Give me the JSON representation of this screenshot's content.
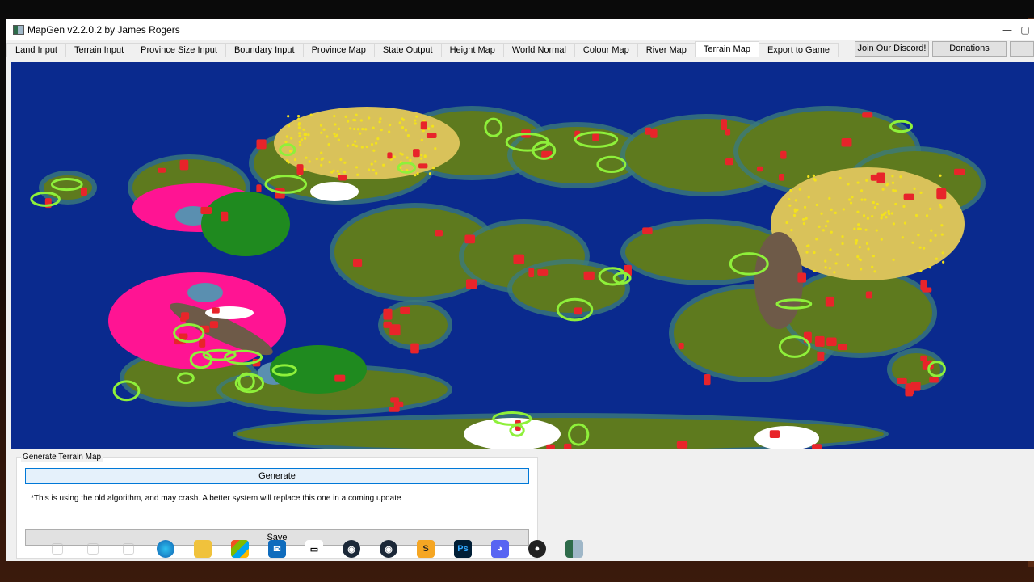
{
  "window": {
    "title": "MapGen v2.2.0.2 by James Rogers",
    "controls": [
      "—",
      "▢"
    ]
  },
  "tabs": [
    {
      "label": "Land Input",
      "active": false
    },
    {
      "label": "Terrain Input",
      "active": false
    },
    {
      "label": "Province Size Input",
      "active": false
    },
    {
      "label": "Boundary Input",
      "active": false
    },
    {
      "label": "Province Map",
      "active": false
    },
    {
      "label": "State Output",
      "active": false
    },
    {
      "label": "Height Map",
      "active": false
    },
    {
      "label": "World Normal",
      "active": false
    },
    {
      "label": "Colour Map",
      "active": false
    },
    {
      "label": "River Map",
      "active": false
    },
    {
      "label": "Terrain Map",
      "active": true
    },
    {
      "label": "Export to Game",
      "active": false
    }
  ],
  "right_buttons": {
    "discord": "Join Our Discord!",
    "donations": "Donations"
  },
  "map": {
    "colors": {
      "ocean": "#0a2a8e",
      "plains": "#5e7a1e",
      "hills": "#e8242a",
      "desert": "#d9c25a",
      "sand_dots": "#f3e21b",
      "mountains": "#6e5a48",
      "snow": "#ffffff",
      "marsh": "#ff1493",
      "lakes": "#5a8fb0",
      "forest": "#1f8a1f",
      "highlight": "#8ef03a",
      "coast": "#3b7a7a"
    }
  },
  "terrain_panel": {
    "group_label": "Generate Terrain Map",
    "generate_label": "Generate",
    "note": "*This is using the old algorithm, and may crash. A better system will replace this one in a coming update",
    "save_label": "Save"
  },
  "taskbar": {
    "icons": [
      "edge-icon",
      "file-explorer-icon",
      "store-icon",
      "mail-icon",
      "media-icon",
      "steam-icon",
      "steam-alt-icon",
      "sublime-icon",
      "photoshop-icon",
      "discord-icon",
      "obs-icon",
      "mapgen-icon"
    ]
  }
}
